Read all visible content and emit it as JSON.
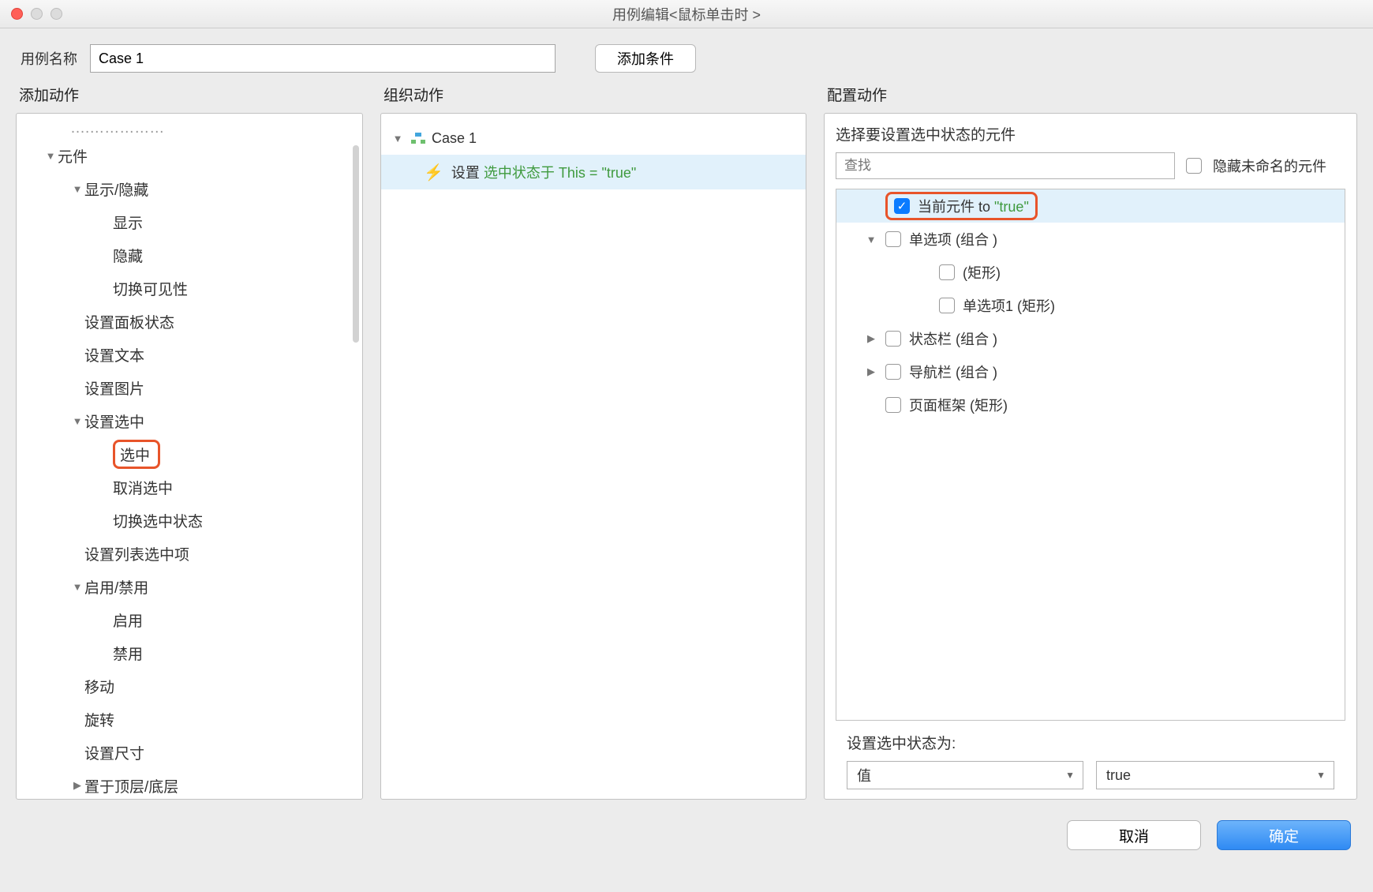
{
  "window": {
    "title": "用例编辑<鼠标单击时 >"
  },
  "top": {
    "case_name_label": "用例名称",
    "case_name_value": "Case 1",
    "add_condition_label": "添加条件"
  },
  "left": {
    "title": "添加动作",
    "truncated_top": "",
    "items": [
      {
        "label": "元件",
        "level": 1,
        "caret": "down"
      },
      {
        "label": "显示/隐藏",
        "level": 2,
        "caret": "down"
      },
      {
        "label": "显示",
        "level": 3
      },
      {
        "label": "隐藏",
        "level": 3
      },
      {
        "label": "切换可见性",
        "level": 3
      },
      {
        "label": "设置面板状态",
        "level": 2
      },
      {
        "label": "设置文本",
        "level": 2
      },
      {
        "label": "设置图片",
        "level": 2
      },
      {
        "label": "设置选中",
        "level": 2,
        "caret": "down"
      },
      {
        "label": "选中",
        "level": 3,
        "highlight": true
      },
      {
        "label": "取消选中",
        "level": 3
      },
      {
        "label": "切换选中状态",
        "level": 3
      },
      {
        "label": "设置列表选中项",
        "level": 2
      },
      {
        "label": "启用/禁用",
        "level": 2,
        "caret": "down"
      },
      {
        "label": "启用",
        "level": 3
      },
      {
        "label": "禁用",
        "level": 3
      },
      {
        "label": "移动",
        "level": 2
      },
      {
        "label": "旋转",
        "level": 2
      },
      {
        "label": "设置尺寸",
        "level": 2
      },
      {
        "label": "置于顶层/底层",
        "level": 2,
        "caret": "right"
      }
    ]
  },
  "middle": {
    "title": "组织动作",
    "case_label": "Case 1",
    "action_prefix": "设置 ",
    "action_green": "选中状态于 This = \"true\""
  },
  "right": {
    "title": "配置动作",
    "subtitle": "选择要设置选中状态的元件",
    "search_placeholder": "查找",
    "hide_unnamed_label": "隐藏未命名的元件",
    "widgets": [
      {
        "label_pre": "当前元件 ",
        "label_mid": "to ",
        "label_green": "\"true\"",
        "checked": true,
        "indent": 1,
        "caret": "none",
        "highlight": true,
        "selected": true
      },
      {
        "label": "单选项 (组合 )",
        "indent": 1,
        "caret": "down"
      },
      {
        "label": "(矩形)",
        "indent": 3,
        "caret": "none"
      },
      {
        "label": "单选项1 (矩形)",
        "indent": 3,
        "caret": "none"
      },
      {
        "label": "状态栏 (组合 )",
        "indent": 1,
        "caret": "right"
      },
      {
        "label": "导航栏 (组合 )",
        "indent": 1,
        "caret": "right"
      },
      {
        "label": "页面框架 (矩形)",
        "indent": 1,
        "caret": "none"
      }
    ],
    "set_state_label": "设置选中状态为:",
    "select1_value": "值",
    "select2_value": "true"
  },
  "footer": {
    "cancel": "取消",
    "ok": "确定"
  }
}
